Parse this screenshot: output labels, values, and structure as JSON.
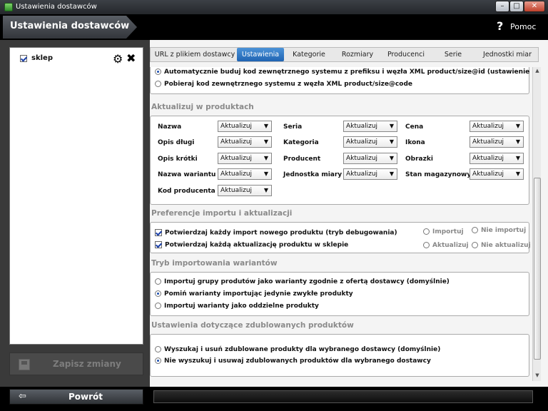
{
  "window": {
    "title": "Ustawienia dostawców"
  },
  "header": {
    "title": "Ustawienia dostawców",
    "help_label": "Pomoc"
  },
  "suppliers": [
    {
      "name": "sklep",
      "checked": true
    }
  ],
  "save_button": {
    "label": "Zapisz zmiany",
    "enabled": false
  },
  "back_button": {
    "label": "Powrót"
  },
  "tabs": [
    {
      "label": "URL z plikiem dostawcy",
      "active": false
    },
    {
      "label": "Ustawienia",
      "active": true
    },
    {
      "label": "Kategorie",
      "active": false
    },
    {
      "label": "Rozmiary",
      "active": false
    },
    {
      "label": "Producenci",
      "active": false
    },
    {
      "label": "Serie",
      "active": false
    },
    {
      "label": "Jednostki miar",
      "active": false
    }
  ],
  "code_options": [
    {
      "label": "Automatycznie buduj kod zewnętrznego systemu z prefiksu i węzła XML product/size@id (ustawienie domyślne)",
      "selected": true
    },
    {
      "label": "Pobieraj kod zewnętrznego systemu z węzła XML product/size@code",
      "selected": false
    }
  ],
  "update_section": {
    "title": "Aktualizuj w produktach",
    "fields": [
      {
        "label": "Nazwa",
        "value": "Aktualizuj"
      },
      {
        "label": "Seria",
        "value": "Aktualizuj"
      },
      {
        "label": "Cena",
        "value": "Aktualizuj"
      },
      {
        "label": "Opis długi",
        "value": "Aktualizuj"
      },
      {
        "label": "Kategoria",
        "value": "Aktualizuj"
      },
      {
        "label": "Ikona",
        "value": "Aktualizuj"
      },
      {
        "label": "Opis krótki",
        "value": "Aktualizuj"
      },
      {
        "label": "Producent",
        "value": "Aktualizuj"
      },
      {
        "label": "Obrazki",
        "value": "Aktualizuj"
      },
      {
        "label": "Nazwa wariantu",
        "value": "Aktualizuj"
      },
      {
        "label": "Jednostka miary",
        "value": "Aktualizuj"
      },
      {
        "label": "Stan magazynowy",
        "value": "Aktualizuj"
      },
      {
        "label": "Kod producenta",
        "value": "Aktualizuj"
      }
    ]
  },
  "prefs_section": {
    "title": "Preferencje importu i aktualizacji",
    "confirm_import": "Potwierdzaj każdy import nowego produktu (tryb debugowania)",
    "confirm_update": "Potwierdzaj każdą aktualizację produktu w sklepie",
    "import_opt": "Importuj",
    "no_import_opt": "Nie importuj",
    "update_opt": "Aktualizuj",
    "no_update_opt": "Nie aktualizuj"
  },
  "variants_section": {
    "title": "Tryb importowania wariantów",
    "options": [
      {
        "label": "Importuj grupy produtów jako warianty zgodnie z ofertą dostawcy (domyślnie)",
        "selected": false
      },
      {
        "label": "Pomiń warianty importując jedynie zwykłe produkty",
        "selected": true
      },
      {
        "label": "Importuj warianty jako oddzielne produkty",
        "selected": false
      }
    ]
  },
  "duplicates_section": {
    "title": "Ustawienia dotyczące zdublowanych produktów",
    "options": [
      {
        "label": "Wyszukaj i usuń zdublowane produkty dla wybranego dostawcy (domyślnie)",
        "selected": false
      },
      {
        "label": "Nie wyszukuj i usuwaj zdublowanych produktów dla wybranego dostawcy",
        "selected": true
      }
    ]
  },
  "colors": {
    "accent": "#2a73c4",
    "header_bg": "#000000",
    "section_title": "#8a8a8a"
  }
}
